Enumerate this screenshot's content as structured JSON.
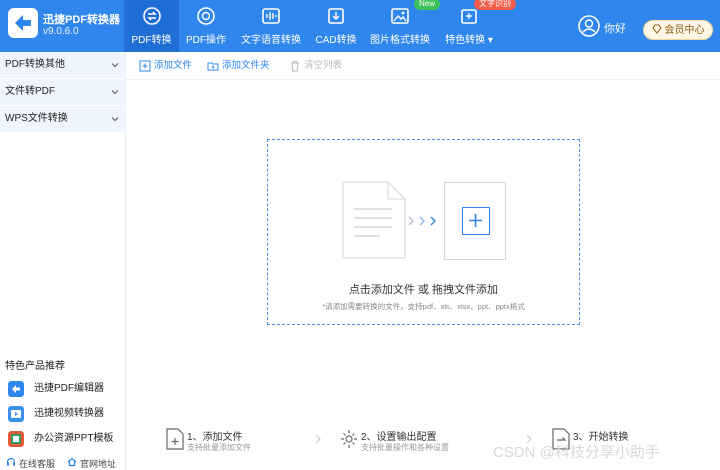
{
  "app": {
    "name": "迅捷PDF转换器",
    "version": "v9.0.6.0"
  },
  "nav": {
    "tabs": [
      {
        "label": "PDF转换",
        "icon": "pdf-convert-icon",
        "active": true
      },
      {
        "label": "PDF操作",
        "icon": "pdf-operate-icon",
        "active": false
      },
      {
        "label": "文字语音转换",
        "icon": "audio-wave-icon",
        "active": false
      },
      {
        "label": "CAD转换",
        "icon": "cad-icon",
        "active": false
      },
      {
        "label": "图片格式转换",
        "icon": "image-icon",
        "active": false,
        "badge": "New"
      },
      {
        "label": "特色转换",
        "icon": "feature-icon",
        "active": false,
        "badge": "文字识别"
      }
    ]
  },
  "user": {
    "greeting": "你好",
    "vip_label": "会员中心"
  },
  "sidebar": {
    "items": [
      {
        "label": "PDF转换其他"
      },
      {
        "label": "文件转PDF"
      },
      {
        "label": "WPS文件转换"
      }
    ],
    "recommend_title": "特色产品推荐",
    "recommend": [
      {
        "label": "迅捷PDF编辑器",
        "icon": "pdf-editor-icon"
      },
      {
        "label": "迅捷视频转换器",
        "icon": "video-converter-icon"
      },
      {
        "label": "办公资源PPT模板",
        "icon": "ppt-template-icon"
      }
    ],
    "links": {
      "service": "在线客服",
      "website": "官网地址"
    }
  },
  "toolbar": {
    "add_file": "添加文件",
    "add_folder": "添加文件夹",
    "clear_list": "清空列表"
  },
  "dropzone": {
    "main": "点击添加文件 或 拖拽文件添加",
    "hint": "*请添加需要转换的文件，支持pdf、xls、xlsx、ppt、pptx格式"
  },
  "steps": [
    {
      "title": "1、添加文件",
      "desc": "支持批量添加文件"
    },
    {
      "title": "2、设置输出配置",
      "desc": "支持批量操作和各种设置"
    },
    {
      "title": "3、开始转换",
      "desc": ""
    }
  ],
  "watermark": "CSDN @科技分享小助手",
  "colors": {
    "brand": "#2f86ec",
    "active_tab": "#1f6fd6",
    "badge_new": "#3cc35a",
    "badge_ocr": "#f35b4a"
  }
}
